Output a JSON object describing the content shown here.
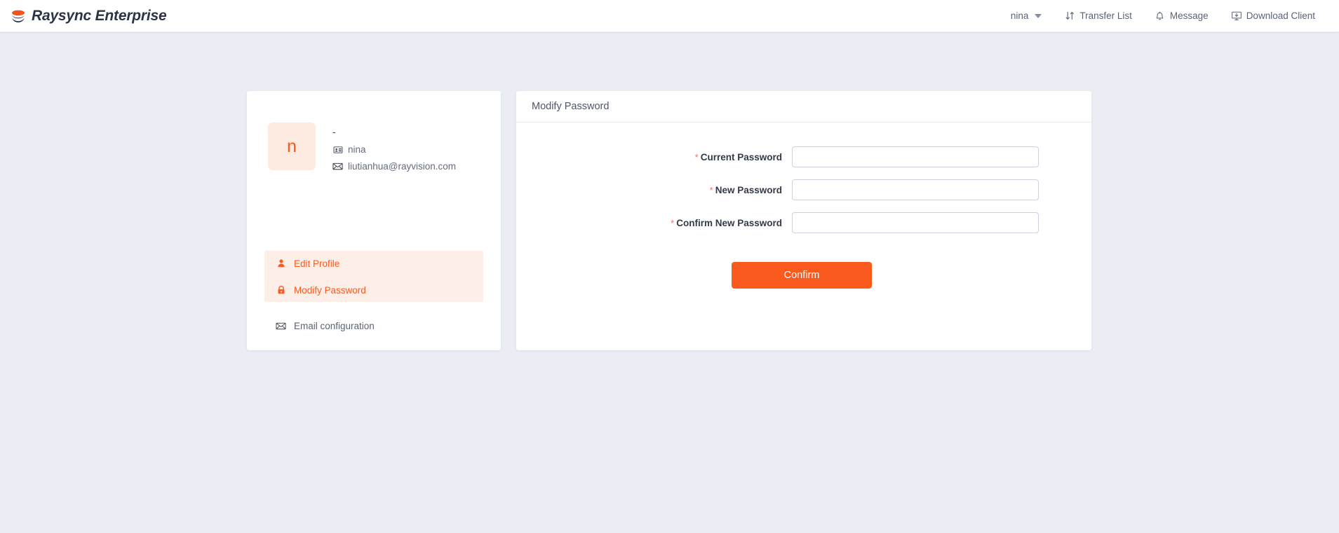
{
  "header": {
    "brand": "Raysync Enterprise",
    "logo_icon": "raysync-layers-logo",
    "nav": [
      {
        "label": "nina",
        "icon": "chevron-down-icon",
        "has_caret": true
      },
      {
        "label": "Transfer List",
        "icon": "transfer-arrows-icon",
        "has_caret": false
      },
      {
        "label": "Message",
        "icon": "bell-icon",
        "has_caret": false
      },
      {
        "label": "Download Client",
        "icon": "monitor-download-icon",
        "has_caret": false
      }
    ]
  },
  "profile": {
    "avatar_letter": "n",
    "display_name": "-",
    "username": "nina",
    "username_icon": "id-card-icon",
    "email": "liutianhua@rayvision.com",
    "email_icon": "envelope-icon",
    "menu": [
      {
        "label": "Edit Profile",
        "icon": "user-icon",
        "active": true
      },
      {
        "label": "Modify Password",
        "icon": "lock-icon",
        "active": true
      },
      {
        "label": "Email configuration",
        "icon": "envelope-icon",
        "active": false
      }
    ]
  },
  "form": {
    "title": "Modify Password",
    "fields": [
      {
        "label": "Current Password",
        "required_mark": "*",
        "value": "",
        "placeholder": ""
      },
      {
        "label": "New Password",
        "required_mark": "*",
        "value": "",
        "placeholder": ""
      },
      {
        "label": "Confirm New Password",
        "required_mark": "*",
        "value": "",
        "placeholder": ""
      }
    ],
    "submit_label": "Confirm"
  },
  "colors": {
    "accent": "#fa5a1e",
    "accent_soft": "#fdeee7",
    "page_bg": "#eaedf4",
    "required": "#f56c6c",
    "text": "#4a5262"
  }
}
